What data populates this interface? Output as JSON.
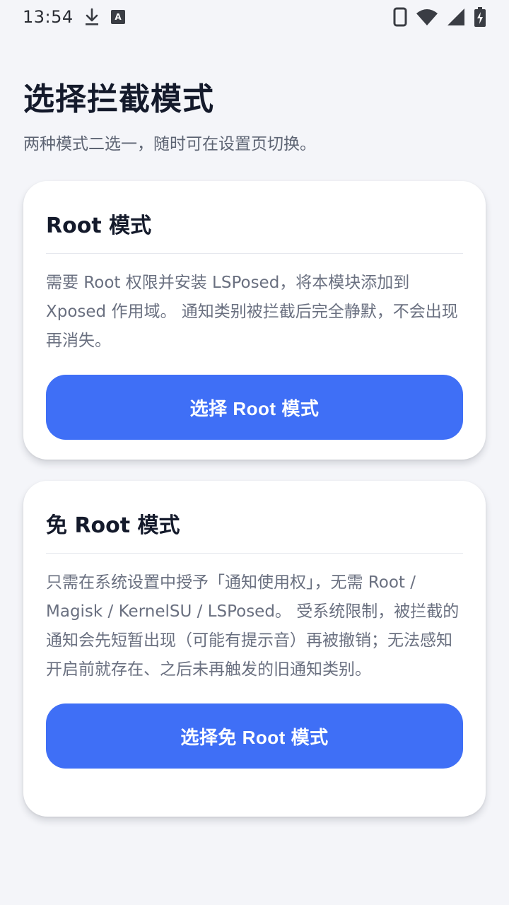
{
  "status_bar": {
    "time": "13:54",
    "left_icons": [
      "download-icon",
      "keyboard-a-icon"
    ],
    "right_icons": [
      "phone-icon",
      "wifi-icon",
      "cellular-signal-icon",
      "battery-charging-icon"
    ]
  },
  "header": {
    "title": "选择拦截模式",
    "subtitle": "两种模式二选一，随时可在设置页切换。"
  },
  "cards": {
    "root": {
      "title": "Root 模式",
      "description": "需要 Root 权限并安装 LSPosed，将本模块添加到 Xposed 作用域。 通知类别被拦截后完全静默，不会出现再消失。",
      "button_label": "选择 Root 模式"
    },
    "no_root": {
      "title": "免 Root 模式",
      "description": "只需在系统设置中授予「通知使用权」，无需 Root / Magisk / KernelSU / LSPosed。 受系统限制，被拦截的通知会先短暂出现（可能有提示音）再被撤销；无法感知开启前就存在、之后未再触发的旧通知类别。",
      "button_label": "选择免 Root 模式"
    }
  },
  "colors": {
    "background": "#f4f5f9",
    "card": "#ffffff",
    "accent": "#3f6ff6",
    "title_text": "#141a2b",
    "body_text": "#6a7080"
  }
}
